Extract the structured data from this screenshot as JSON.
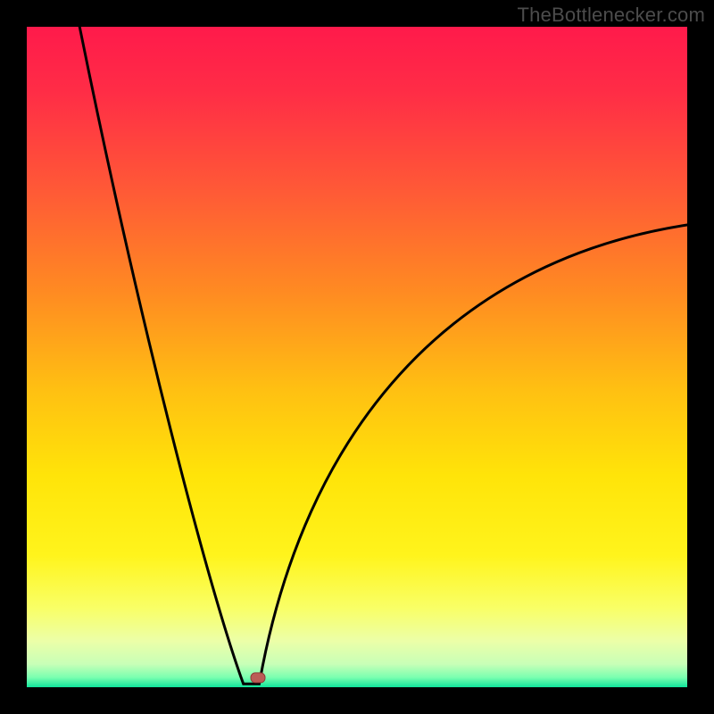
{
  "watermark": "TheBottlenecker.com",
  "colors": {
    "gradient_stops": [
      {
        "offset": 0.0,
        "color": "#ff1a4b"
      },
      {
        "offset": 0.1,
        "color": "#ff2d46"
      },
      {
        "offset": 0.25,
        "color": "#ff5a36"
      },
      {
        "offset": 0.4,
        "color": "#ff8a22"
      },
      {
        "offset": 0.55,
        "color": "#ffc012"
      },
      {
        "offset": 0.68,
        "color": "#ffe409"
      },
      {
        "offset": 0.8,
        "color": "#fff41c"
      },
      {
        "offset": 0.88,
        "color": "#f9ff66"
      },
      {
        "offset": 0.93,
        "color": "#ecffa8"
      },
      {
        "offset": 0.965,
        "color": "#c8ffb7"
      },
      {
        "offset": 0.985,
        "color": "#7bffb0"
      },
      {
        "offset": 1.0,
        "color": "#10e59b"
      }
    ],
    "curve": "#000000",
    "marker_fill": "#bb5c56",
    "marker_stroke": "#8e3d38",
    "frame": "#000000"
  },
  "chart_data": {
    "type": "line",
    "title": "",
    "xlabel": "",
    "ylabel": "",
    "xlim": [
      0,
      100
    ],
    "ylim": [
      0,
      100
    ],
    "grid": false,
    "series": [
      {
        "name": "bottleneck-curve",
        "x_notch": 34,
        "y_notch": 0,
        "left_top_x": 8,
        "left_top_y": 100,
        "right_top_x": 100,
        "right_top_y": 70,
        "note": "V-shaped curve: steep left branch from (8,100) to bottom at x≈34, curved right branch rising to (100,70)."
      }
    ],
    "marker": {
      "x": 35,
      "y": 1.5,
      "kind": "rounded-rect"
    }
  }
}
